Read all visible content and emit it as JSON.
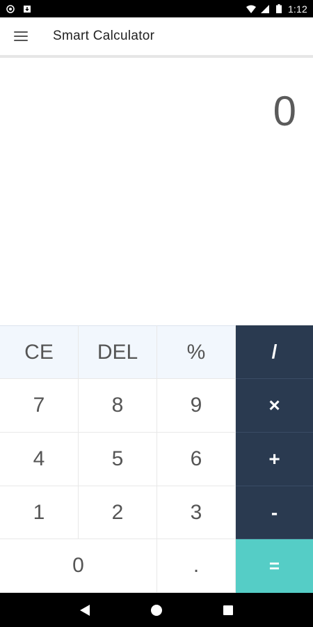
{
  "status_bar": {
    "time": "1:12",
    "icons": [
      "shield-icon",
      "download-icon",
      "wifi-icon",
      "signal-icon",
      "battery-icon"
    ]
  },
  "app_bar": {
    "title": "Smart Calculator",
    "menu_icon": "menu-icon"
  },
  "display": {
    "value": "0"
  },
  "keypad": {
    "rows": [
      [
        "CE",
        "DEL",
        "%",
        "/"
      ],
      [
        "7",
        "8",
        "9",
        "×"
      ],
      [
        "4",
        "5",
        "6",
        "+"
      ],
      [
        "1",
        "2",
        "3",
        "-"
      ],
      [
        "0",
        ".",
        "="
      ]
    ]
  },
  "colors": {
    "operator_bg": "#2a3a50",
    "equals_bg": "#55cdc6",
    "top_row_bg": "#f2f7fd"
  },
  "nav_bar": {
    "icons": [
      "back-icon",
      "home-icon",
      "recents-icon"
    ]
  }
}
